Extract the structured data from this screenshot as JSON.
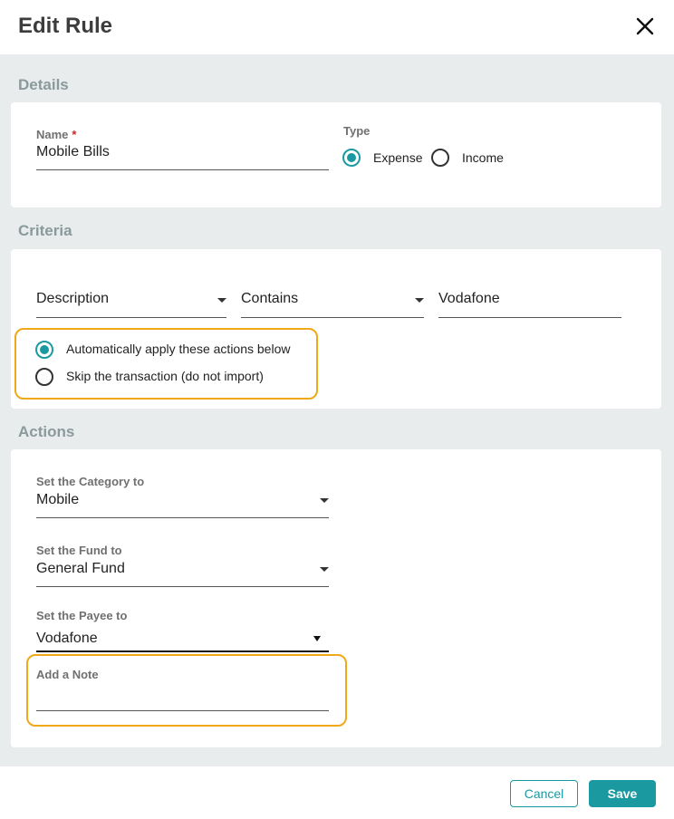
{
  "dialog": {
    "title": "Edit Rule"
  },
  "details": {
    "section_title": "Details",
    "name_label": "Name",
    "required_mark": "*",
    "name_value": "Mobile Bills",
    "type_label": "Type",
    "type_options": [
      "Expense",
      "Income"
    ],
    "type_selected": "Expense"
  },
  "criteria": {
    "section_title": "Criteria",
    "field": "Description",
    "operator": "Contains",
    "value": "Vodafone",
    "options": [
      "Automatically apply these actions below",
      "Skip the transaction (do not import)"
    ],
    "selected": "Automatically apply these actions below"
  },
  "actions": {
    "section_title": "Actions",
    "category_label": "Set the Category to",
    "category_value": "Mobile",
    "fund_label": "Set the Fund to",
    "fund_value": "General Fund",
    "payee_label": "Set the Payee to",
    "payee_value": "Vodafone",
    "note_label": "Add a Note",
    "note_value": ""
  },
  "footer": {
    "cancel_label": "Cancel",
    "save_label": "Save"
  },
  "colors": {
    "accent": "#1a9aa0",
    "highlight": "#f0a818",
    "required": "#c62828"
  }
}
